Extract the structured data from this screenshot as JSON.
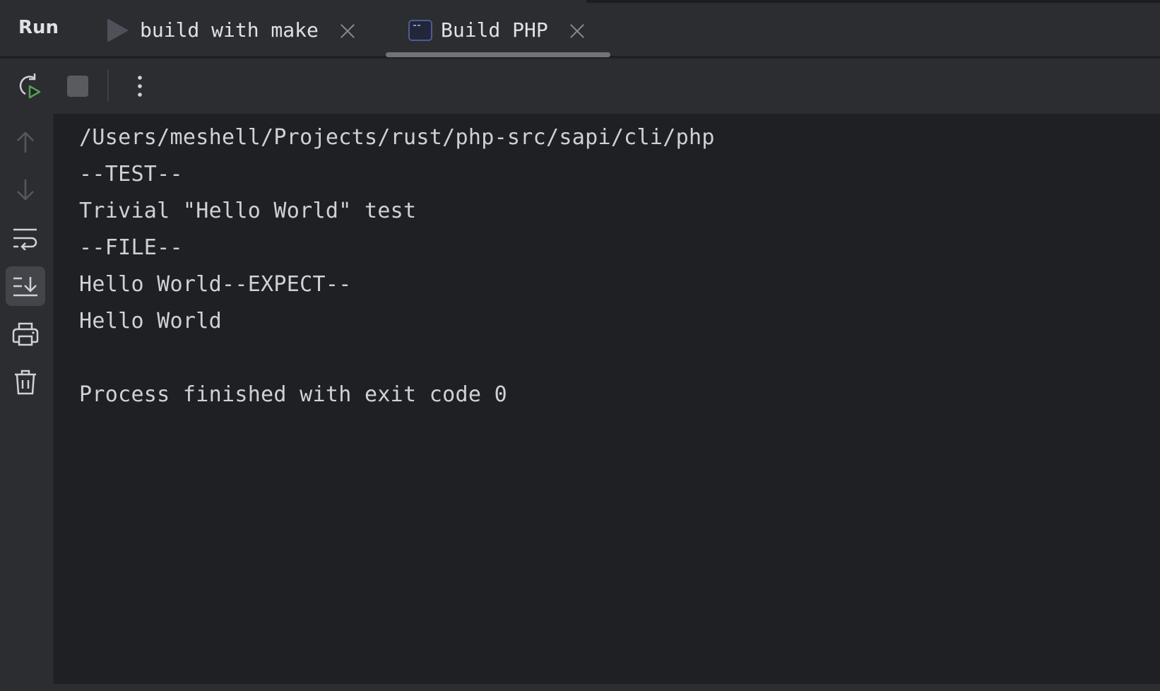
{
  "window": {
    "panel_title": "Run"
  },
  "tabs": [
    {
      "label": "build with make",
      "icon": "play-icon",
      "active": false
    },
    {
      "label": "Build PHP",
      "icon": "terminal-icon",
      "active": true
    }
  ],
  "toolbar": {
    "buttons": [
      {
        "name": "rerun-button",
        "icon": "rerun-icon",
        "color": "#5a9e5a"
      },
      {
        "name": "stop-button",
        "icon": "stop-icon",
        "enabled": false
      },
      {
        "name": "more-options-button",
        "icon": "more-vertical-icon"
      }
    ]
  },
  "gutter": {
    "buttons": [
      {
        "name": "scroll-up-button",
        "icon": "arrow-up-icon",
        "enabled": false
      },
      {
        "name": "scroll-down-button",
        "icon": "arrow-down-icon",
        "enabled": false
      },
      {
        "name": "soft-wrap-button",
        "icon": "soft-wrap-icon",
        "active": false
      },
      {
        "name": "scroll-to-end-button",
        "icon": "scroll-to-end-icon",
        "active": true
      },
      {
        "name": "print-button",
        "icon": "printer-icon",
        "active": false
      },
      {
        "name": "clear-all-button",
        "icon": "trash-icon",
        "active": false
      }
    ]
  },
  "console": {
    "lines": [
      "/Users/meshell/Projects/rust/php-src/sapi/cli/php",
      "--TEST--",
      "Trivial \"Hello World\" test",
      "--FILE--",
      "Hello World--EXPECT--",
      "Hello World",
      "",
      "Process finished with exit code 0"
    ]
  },
  "colors": {
    "background": "#1f2024",
    "panel": "#2b2d31",
    "text": "#cfd1d6",
    "accent_green": "#5a9e5a",
    "terminal_icon_blue": "#4b5e94"
  }
}
